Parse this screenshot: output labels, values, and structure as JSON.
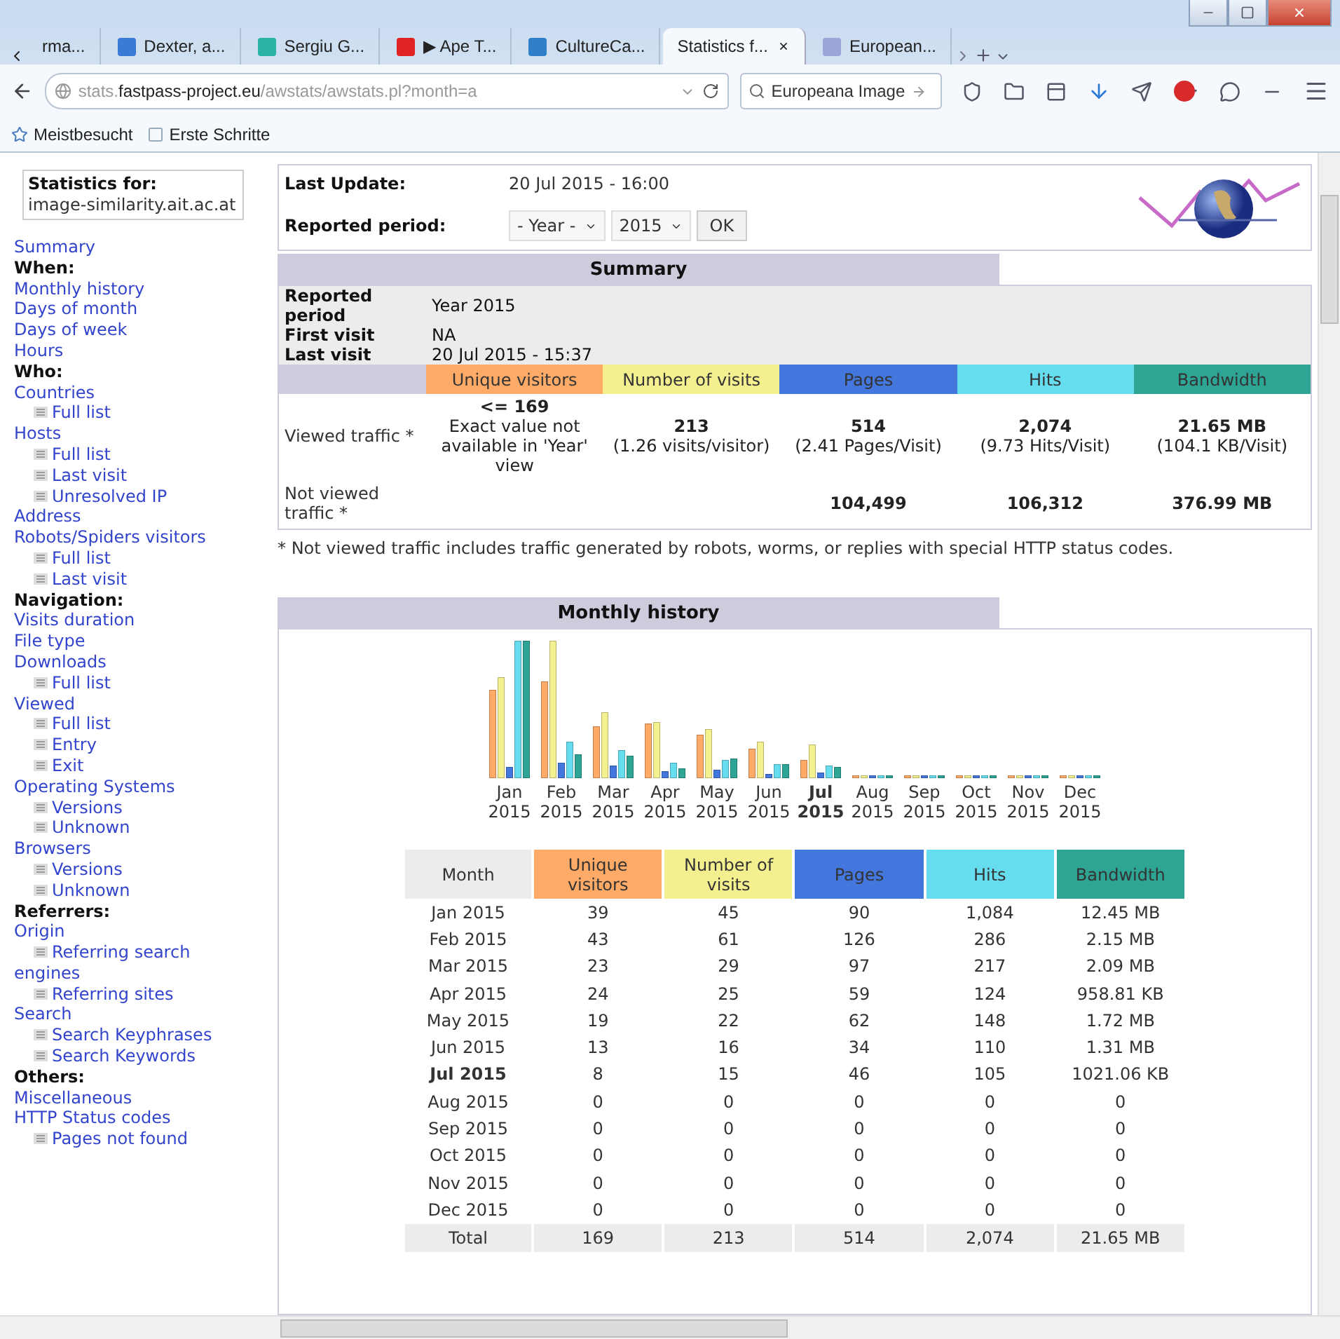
{
  "browser": {
    "tabs": [
      {
        "label": "rma...",
        "selected": false
      },
      {
        "label": "Dexter, a...",
        "selected": false,
        "color": "#3a7bd5"
      },
      {
        "label": "Sergiu G...",
        "selected": false,
        "color": "#2bb3a3"
      },
      {
        "label": "▶ Ape T...",
        "selected": false,
        "color": "#e02424"
      },
      {
        "label": "CultureCa...",
        "selected": false,
        "color": "#2f80c8"
      },
      {
        "label": "Statistics f...",
        "selected": true
      },
      {
        "label": "European...",
        "selected": false,
        "color": "#9aa6d8"
      }
    ],
    "url": {
      "prefix": "stats.",
      "domain": "fastpass-project.eu",
      "path": "/awstats/awstats.pl?month=a"
    },
    "search": {
      "value": "Europeana Image"
    },
    "bookmarks": [
      "Meistbesucht",
      "Erste Schritte"
    ]
  },
  "sidebar": {
    "title": "Statistics for:",
    "site": "image-similarity.ait.ac.at",
    "items": [
      {
        "kind": "link",
        "label": "Summary"
      },
      {
        "kind": "heading",
        "label": "When:"
      },
      {
        "kind": "link",
        "label": "Monthly history"
      },
      {
        "kind": "link",
        "label": "Days of month"
      },
      {
        "kind": "link",
        "label": "Days of week"
      },
      {
        "kind": "link",
        "label": "Hours"
      },
      {
        "kind": "heading",
        "label": "Who:"
      },
      {
        "kind": "link",
        "label": "Countries"
      },
      {
        "kind": "sublink",
        "label": "Full list"
      },
      {
        "kind": "link",
        "label": "Hosts"
      },
      {
        "kind": "sublink",
        "label": "Full list"
      },
      {
        "kind": "sublink",
        "label": "Last visit"
      },
      {
        "kind": "sublink",
        "label": "Unresolved IP Address"
      },
      {
        "kind": "link",
        "label": "Robots/Spiders visitors"
      },
      {
        "kind": "sublink",
        "label": "Full list"
      },
      {
        "kind": "sublink",
        "label": "Last visit"
      },
      {
        "kind": "heading",
        "label": "Navigation:"
      },
      {
        "kind": "link",
        "label": "Visits duration"
      },
      {
        "kind": "link",
        "label": "File type"
      },
      {
        "kind": "link",
        "label": "Downloads"
      },
      {
        "kind": "sublink",
        "label": "Full list"
      },
      {
        "kind": "link",
        "label": "Viewed"
      },
      {
        "kind": "sublink",
        "label": "Full list"
      },
      {
        "kind": "sublink",
        "label": "Entry"
      },
      {
        "kind": "sublink",
        "label": "Exit"
      },
      {
        "kind": "link",
        "label": "Operating Systems"
      },
      {
        "kind": "sublink",
        "label": "Versions"
      },
      {
        "kind": "sublink",
        "label": "Unknown"
      },
      {
        "kind": "link",
        "label": "Browsers"
      },
      {
        "kind": "sublink",
        "label": "Versions"
      },
      {
        "kind": "sublink",
        "label": "Unknown"
      },
      {
        "kind": "heading",
        "label": "Referrers:"
      },
      {
        "kind": "link",
        "label": "Origin"
      },
      {
        "kind": "sublink",
        "label": "Referring search engines"
      },
      {
        "kind": "sublink",
        "label": "Referring sites"
      },
      {
        "kind": "link",
        "label": "Search"
      },
      {
        "kind": "sublink",
        "label": "Search Keyphrases"
      },
      {
        "kind": "sublink",
        "label": "Search Keywords"
      },
      {
        "kind": "heading",
        "label": "Others:"
      },
      {
        "kind": "link",
        "label": "Miscellaneous"
      },
      {
        "kind": "link",
        "label": "HTTP Status codes"
      },
      {
        "kind": "sublink",
        "label": "Pages not found"
      }
    ]
  },
  "header": {
    "last_update_label": "Last Update:",
    "last_update": "20 Jul 2015 - 16:00",
    "period_label": "Reported period:",
    "period_select": "- Year -",
    "year_select": "2015",
    "ok": "OK"
  },
  "summary": {
    "title": "Summary",
    "info": [
      {
        "label": "Reported period",
        "value": "Year 2015"
      },
      {
        "label": "First visit",
        "value": "NA"
      },
      {
        "label": "Last visit",
        "value": "20 Jul 2015 - 15:37"
      }
    ],
    "columns": [
      {
        "label": "Unique visitors",
        "color": "#ffaa66"
      },
      {
        "label": "Number of visits",
        "color": "#f4f090"
      },
      {
        "label": "Pages",
        "color": "#4477dd"
      },
      {
        "label": "Hits",
        "color": "#66ddee"
      },
      {
        "label": "Bandwidth",
        "color": "#2ea495"
      }
    ],
    "viewed": {
      "label": "Viewed traffic *",
      "cells": [
        {
          "value": "<= 169",
          "note": "Exact value not available in 'Year' view"
        },
        {
          "value": "213",
          "note": "(1.26 visits/visitor)"
        },
        {
          "value": "514",
          "note": "(2.41 Pages/Visit)"
        },
        {
          "value": "2,074",
          "note": "(9.73 Hits/Visit)"
        },
        {
          "value": "21.65 MB",
          "note": "(104.1 KB/Visit)"
        }
      ]
    },
    "not_viewed": {
      "label": "Not viewed traffic *",
      "cells": [
        "",
        "",
        "104,499",
        "106,312",
        "376.99 MB"
      ]
    },
    "footnote": "* Not viewed traffic includes traffic generated by robots, worms, or replies with special HTTP status codes."
  },
  "monthly": {
    "title": "Monthly history",
    "chart_labels": [
      {
        "month": "Jan",
        "year": "2015",
        "current": false
      },
      {
        "month": "Feb",
        "year": "2015",
        "current": false
      },
      {
        "month": "Mar",
        "year": "2015",
        "current": false
      },
      {
        "month": "Apr",
        "year": "2015",
        "current": false
      },
      {
        "month": "May",
        "year": "2015",
        "current": false
      },
      {
        "month": "Jun",
        "year": "2015",
        "current": false
      },
      {
        "month": "Jul",
        "year": "2015",
        "current": true
      },
      {
        "month": "Aug",
        "year": "2015",
        "current": false
      },
      {
        "month": "Sep",
        "year": "2015",
        "current": false
      },
      {
        "month": "Oct",
        "year": "2015",
        "current": false
      },
      {
        "month": "Nov",
        "year": "2015",
        "current": false
      },
      {
        "month": "Dec",
        "year": "2015",
        "current": false
      }
    ],
    "columns": [
      "Month",
      "Unique visitors",
      "Number of visits",
      "Pages",
      "Hits",
      "Bandwidth"
    ],
    "rows": [
      {
        "current": false,
        "cells": [
          "Jan 2015",
          "39",
          "45",
          "90",
          "1,084",
          "12.45 MB"
        ]
      },
      {
        "current": false,
        "cells": [
          "Feb 2015",
          "43",
          "61",
          "126",
          "286",
          "2.15 MB"
        ]
      },
      {
        "current": false,
        "cells": [
          "Mar 2015",
          "23",
          "29",
          "97",
          "217",
          "2.09 MB"
        ]
      },
      {
        "current": false,
        "cells": [
          "Apr 2015",
          "24",
          "25",
          "59",
          "124",
          "958.81 KB"
        ]
      },
      {
        "current": false,
        "cells": [
          "May 2015",
          "19",
          "22",
          "62",
          "148",
          "1.72 MB"
        ]
      },
      {
        "current": false,
        "cells": [
          "Jun 2015",
          "13",
          "16",
          "34",
          "110",
          "1.31 MB"
        ]
      },
      {
        "current": true,
        "cells": [
          "Jul 2015",
          "8",
          "15",
          "46",
          "105",
          "1021.06 KB"
        ]
      },
      {
        "current": false,
        "cells": [
          "Aug 2015",
          "0",
          "0",
          "0",
          "0",
          "0"
        ]
      },
      {
        "current": false,
        "cells": [
          "Sep 2015",
          "0",
          "0",
          "0",
          "0",
          "0"
        ]
      },
      {
        "current": false,
        "cells": [
          "Oct 2015",
          "0",
          "0",
          "0",
          "0",
          "0"
        ]
      },
      {
        "current": false,
        "cells": [
          "Nov 2015",
          "0",
          "0",
          "0",
          "0",
          "0"
        ]
      },
      {
        "current": false,
        "cells": [
          "Dec 2015",
          "0",
          "0",
          "0",
          "0",
          "0"
        ]
      }
    ],
    "total": [
      "Total",
      "169",
      "213",
      "514",
      "2,074",
      "21.65 MB"
    ]
  }
}
